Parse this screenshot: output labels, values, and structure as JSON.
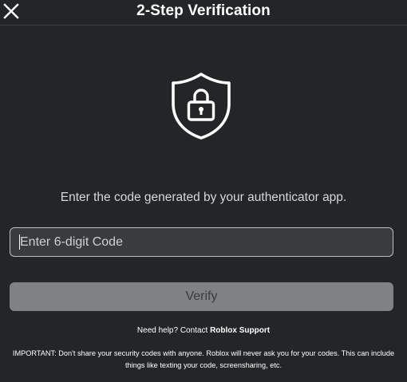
{
  "header": {
    "title": "2-Step Verification",
    "close_icon": "close-icon"
  },
  "main": {
    "icon": "shield-lock-icon",
    "instruction": "Enter the code generated by your authenticator app.",
    "code_input": {
      "placeholder": "Enter 6-digit Code",
      "value": ""
    },
    "verify_label": "Verify"
  },
  "footer": {
    "help_prefix": "Need help? Contact ",
    "help_link": "Roblox Support",
    "important_notice": "IMPORTANT: Don't share your security codes with anyone. Roblox will never ask you for your codes. This can include things like texting your code, screensharing, etc."
  },
  "colors": {
    "background": "#232527",
    "input_background": "#393b3d",
    "button_disabled": "#808184",
    "text": "#ffffff"
  }
}
